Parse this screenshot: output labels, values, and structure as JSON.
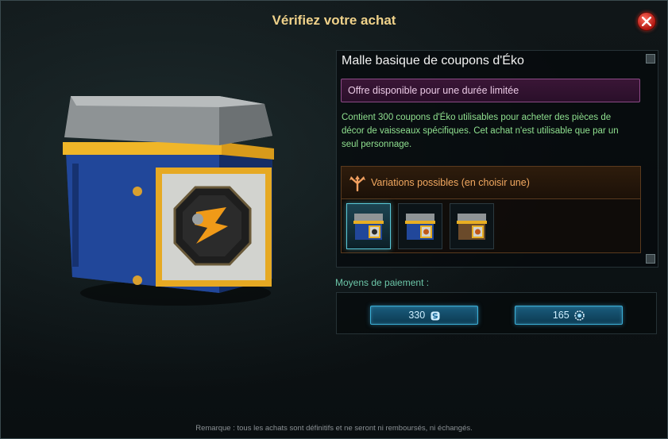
{
  "dialog": {
    "title": "Vérifiez votre achat",
    "close_icon": "close-icon"
  },
  "item": {
    "name": "Malle basique de coupons d'Éko",
    "offer": "Offre disponible pour une durée limitée",
    "description": "Contient 300 coupons d'Éko utilisables pour acheter des pièces de décor de vaisseaux spécifiques. Cet achat n'est utilisable que par un seul personnage.",
    "variations": {
      "label": "Variations possibles (en choisir une)",
      "icon": "branch-arrows-icon",
      "selected_index": 0,
      "options": [
        "chest-variant-1",
        "chest-variant-2",
        "chest-variant-3"
      ]
    }
  },
  "payment": {
    "label": "Moyens de paiement :",
    "options": [
      {
        "amount": "330",
        "icon": "premium-currency-icon"
      },
      {
        "amount": "165",
        "icon": "coupon-currency-icon"
      }
    ]
  },
  "remark": "Remarque : tous les achats sont définitifs et ne seront ni remboursés, ni échangés.",
  "colors": {
    "title": "#f0d28a",
    "description": "#8fe08f",
    "offer_bg": "#3a1636",
    "variations_label": "#f2a860",
    "button_border": "#3ab0d8"
  }
}
